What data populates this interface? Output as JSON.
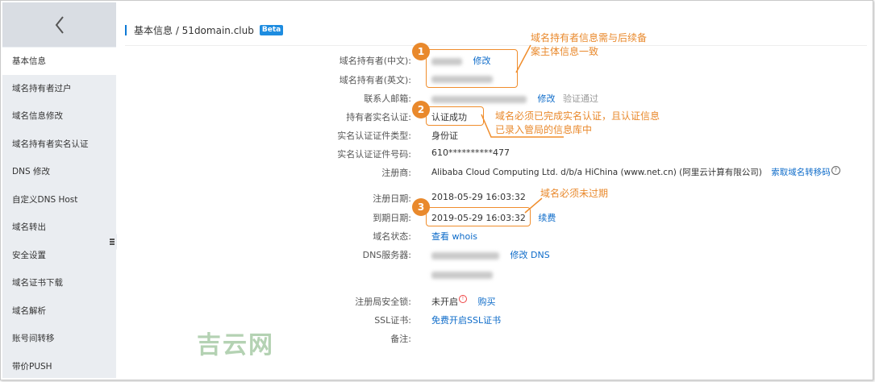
{
  "sidebar": {
    "items": [
      {
        "label": "基本信息"
      },
      {
        "label": "域名持有者过户"
      },
      {
        "label": "域名信息修改"
      },
      {
        "label": "域名持有者实名认证"
      },
      {
        "label": "DNS 修改"
      },
      {
        "label": "自定义DNS Host"
      },
      {
        "label": "域名转出"
      },
      {
        "label": "安全设置"
      },
      {
        "label": "域名证书下载"
      },
      {
        "label": "域名解析"
      },
      {
        "label": "账号间转移"
      },
      {
        "label": "带价PUSH"
      }
    ]
  },
  "header": {
    "title": "基本信息 / 51domain.club",
    "badge": "Beta"
  },
  "info": {
    "holder_cn_label": "域名持有者(中文):",
    "holder_en_label": "域名持有者(英文):",
    "email_label": "联系人邮箱:",
    "realname_label": "持有者实名认证:",
    "cert_type_label": "实名认证证件类型:",
    "cert_no_label": "实名认证证件号码:",
    "registrar_label": "注册商:",
    "reg_date_label": "注册日期:",
    "exp_date_label": "到期日期:",
    "status_label": "域名状态:",
    "dns_label": "DNS服务器:",
    "lock_label": "注册局安全锁:",
    "ssl_label": "SSL证书:",
    "remark_label": "备注:",
    "edit_link": "修改",
    "verified_text": "验证通过",
    "realname_value": "认证成功",
    "cert_type_value": "身份证",
    "cert_no_value": "610**********477",
    "registrar_value": "Alibaba Cloud Computing Ltd. d/b/a HiChina (www.net.cn) (阿里云计算有限公司)",
    "transfer_code_link": "索取域名转移码",
    "reg_date_value": "2018-05-29 16:03:32",
    "exp_date_value": "2019-05-29 16:03:32",
    "renew_link": "续费",
    "whois_link": "查看 whois",
    "edit_dns_link": "修改 DNS",
    "lock_value": "未开启",
    "buy_link": "购买",
    "ssl_link": "免费开启SSL证书"
  },
  "annotations": {
    "badge1": "1",
    "badge2": "2",
    "badge3": "3",
    "note1": "域名持有者信息需与后续备案主体信息一致",
    "note2": "域名必须已完成实名认证，且认证信息已录入管局的信息库中",
    "note3": "域名必须未过期",
    "accent_color": "#e9892c"
  },
  "watermark": "吉云网",
  "icons": {
    "back": "chevron-left-icon",
    "help": "question-circle-icon",
    "warning": "warning-icon",
    "collapse": "collapse-icon"
  },
  "colors": {
    "link": "#0d6bc9",
    "beta": "#1d8ce0",
    "sidebar_bg": "#eaedf1"
  }
}
